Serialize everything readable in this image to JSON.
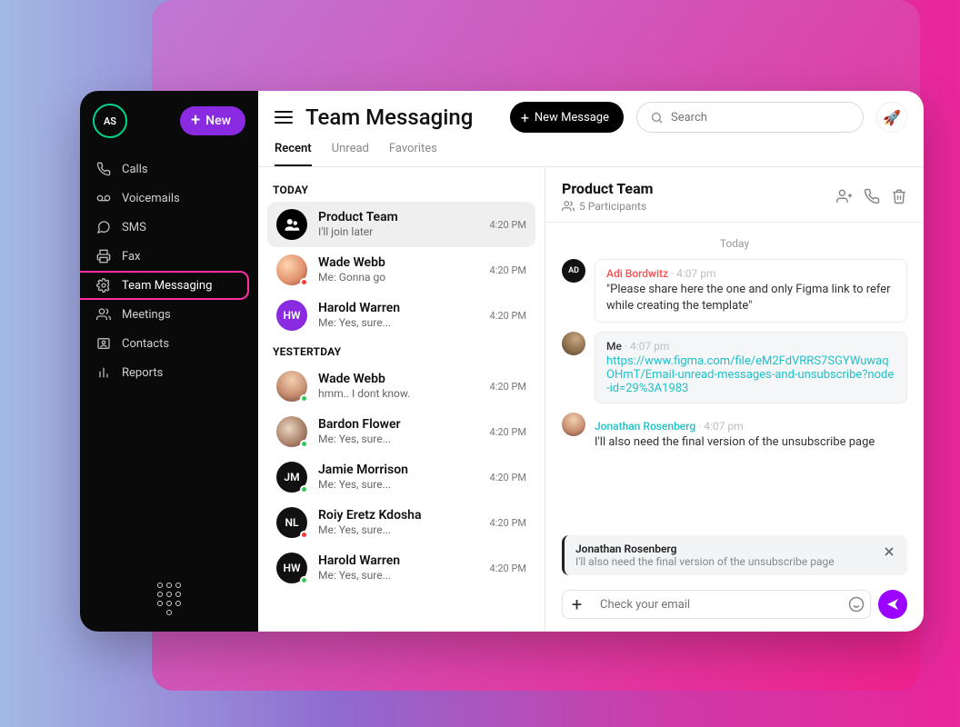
{
  "sidebar": {
    "me_initials": "AS",
    "new_label": "New",
    "items": [
      {
        "label": "Calls"
      },
      {
        "label": "Voicemails"
      },
      {
        "label": "SMS"
      },
      {
        "label": "Fax"
      },
      {
        "label": "Team Messaging"
      },
      {
        "label": "Meetings"
      },
      {
        "label": "Contacts"
      },
      {
        "label": "Reports"
      }
    ]
  },
  "header": {
    "title": "Team Messaging",
    "new_message_label": "New Message",
    "search_placeholder": "Search"
  },
  "tabs": [
    "Recent",
    "Unread",
    "Favorites"
  ],
  "list": {
    "today_label": "TODAY",
    "yesterday_label": "YESTERTDAY",
    "today": [
      {
        "name": "Product Team",
        "snippet": "I'll join later",
        "time": "4:20 PM"
      },
      {
        "name": "Wade Webb",
        "snippet": "Me: Gonna go",
        "time": "4:20 PM"
      },
      {
        "name": "Harold Warren",
        "snippet": "Me: Yes, sure...",
        "time": "4:20 PM",
        "initials": "HW"
      }
    ],
    "yesterday": [
      {
        "name": "Wade Webb",
        "snippet": "hmm.. I dont know.",
        "time": "4:20 PM"
      },
      {
        "name": "Bardon Flower",
        "snippet": "Me: Yes, sure...",
        "time": "4:20 PM"
      },
      {
        "name": "Jamie Morrison",
        "snippet": "Me: Yes, sure...",
        "time": "4:20 PM",
        "initials": "JM"
      },
      {
        "name": "Roiy Eretz Kdosha",
        "snippet": "Me: Yes, sure...",
        "time": "4:20 PM",
        "initials": "NL"
      },
      {
        "name": "Harold Warren",
        "snippet": "Me: Yes, sure...",
        "time": "4:20 PM",
        "initials": "HW"
      }
    ]
  },
  "chat": {
    "title": "Product Team",
    "participants_label": "5 Participants",
    "date_label": "Today",
    "messages": [
      {
        "sender": "Adi Bordwitz",
        "time": "4:07 pm",
        "text": "\"Please share here the one and only Figma link to refer while creating the template\"",
        "color": "red",
        "initials": "AD"
      },
      {
        "sender": "Me",
        "time": "4:07 pm",
        "link": "https://www.figma.com/file/eM2FdVRRS7SGYWuwaqOHmT/Email-unread-messages-and-unsubscribe?node-id=29%3A1983",
        "highlight": true
      },
      {
        "sender": "Jonathan Rosenberg",
        "time": "4:07 pm",
        "text": "I'll also need the final version of the unsubscribe page",
        "color": "teal"
      }
    ],
    "reply": {
      "name": "Jonathan Rosenberg",
      "text": "I'll also need the final version of the unsubscribe page"
    },
    "compose_placeholder": "Check your email"
  }
}
